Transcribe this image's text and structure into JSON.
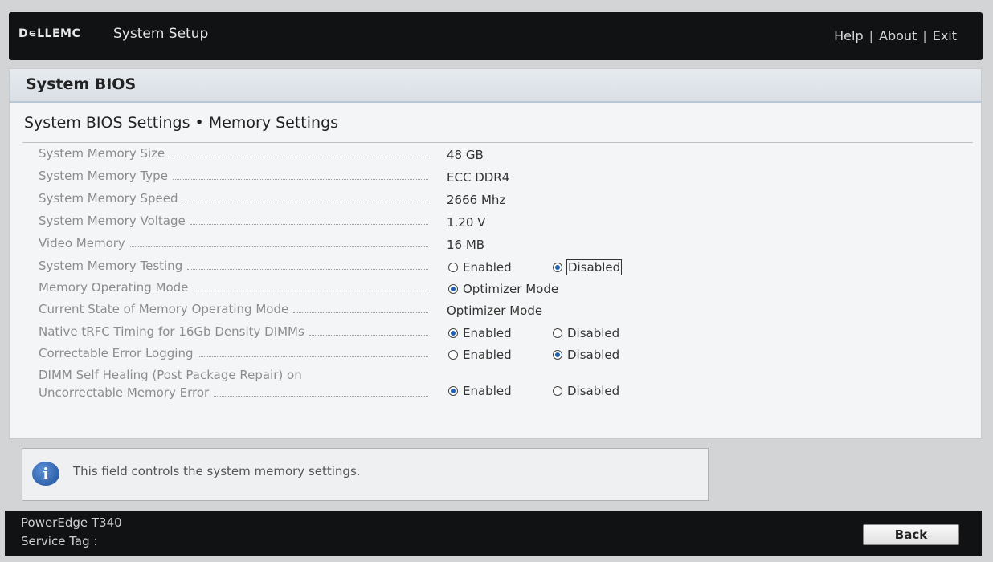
{
  "header": {
    "brand": "D∊LLEMC",
    "app_title": "System Setup",
    "links": [
      "Help",
      "About",
      "Exit"
    ]
  },
  "panel": {
    "title": "System BIOS",
    "section_title": "System BIOS Settings • Memory Settings"
  },
  "settings": [
    {
      "label": "System Memory Size",
      "value": "48 GB"
    },
    {
      "label": "System Memory Type",
      "value": "ECC DDR4"
    },
    {
      "label": "System Memory Speed",
      "value": "2666 Mhz"
    },
    {
      "label": "System Memory Voltage",
      "value": "1.20 V"
    },
    {
      "label": "Video Memory",
      "value": "16 MB"
    },
    {
      "label": "System Memory Testing",
      "options": [
        "Enabled",
        "Disabled"
      ],
      "selected": "Disabled"
    },
    {
      "label": "Memory Operating Mode",
      "options": [
        "Optimizer Mode"
      ],
      "selected": "Optimizer Mode"
    },
    {
      "label": "Current State of Memory Operating Mode",
      "value": "Optimizer Mode"
    },
    {
      "label": "Native tRFC Timing for 16Gb Density DIMMs",
      "options": [
        "Enabled",
        "Disabled"
      ],
      "selected": "Enabled"
    },
    {
      "label": "Correctable Error Logging",
      "options": [
        "Enabled",
        "Disabled"
      ],
      "selected": "Disabled"
    },
    {
      "label_line1": "DIMM Self Healing (Post Package Repair) on",
      "label": "Uncorrectable Memory Error",
      "options": [
        "Enabled",
        "Disabled"
      ],
      "selected": "Enabled"
    }
  ],
  "help": {
    "icon": "info-icon",
    "text": "This field controls the system memory settings."
  },
  "footer": {
    "model": "PowerEdge T340",
    "service_tag_label": "Service Tag :",
    "back_label": "Back"
  }
}
